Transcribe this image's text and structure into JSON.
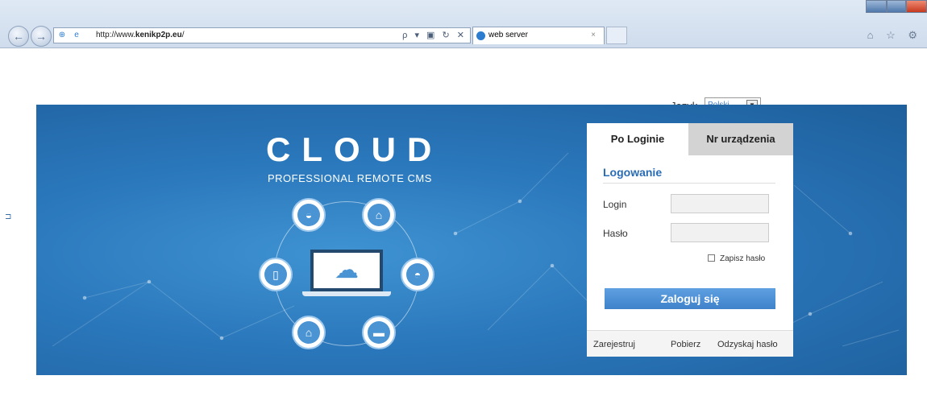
{
  "browser": {
    "address_prefix": "http://www.",
    "address_domain": "kenikp2p.eu",
    "address_suffix": "/",
    "address_tools": "ρ ▾ ▣ ↻ ✕",
    "tab_label": "web server",
    "tab_close": "×",
    "nav_back": "←",
    "nav_forward": "→",
    "right_icons": "⌂ ☆ ⚙"
  },
  "language": {
    "label": "Język",
    "selected": "Polski",
    "arrow": "▼"
  },
  "banner": {
    "title": "CLOUD",
    "subtitle": "PROFESSIONAL REMOTE CMS",
    "devices": [
      {
        "icon": "dome-camera-icon",
        "glyph": "◒"
      },
      {
        "icon": "bullet-camera-icon",
        "glyph": "⌂"
      },
      {
        "icon": "mobile-phone-icon",
        "glyph": "▯"
      },
      {
        "icon": "speed-dome-camera-icon",
        "glyph": "◓"
      },
      {
        "icon": "bullet-camera-icon",
        "glyph": "⌂"
      },
      {
        "icon": "dvr-recorder-icon",
        "glyph": "▬"
      }
    ],
    "laptop_glyph": "☁"
  },
  "login": {
    "tab_login": "Po Loginie",
    "tab_device": "Nr urządzenia",
    "form_title": "Logowanie",
    "login_label": "Login",
    "password_label": "Hasło",
    "remember_label": "Zapisz hasło",
    "submit_label": "Zaloguj się",
    "link_register": "Zarejestruj",
    "link_download": "Pobierz",
    "link_recover": "Odzyskaj hasło"
  },
  "colors": {
    "banner_blue": "#2a77bb",
    "accent_blue": "#2a6cb4",
    "button_blue": "#4a8ed4"
  }
}
